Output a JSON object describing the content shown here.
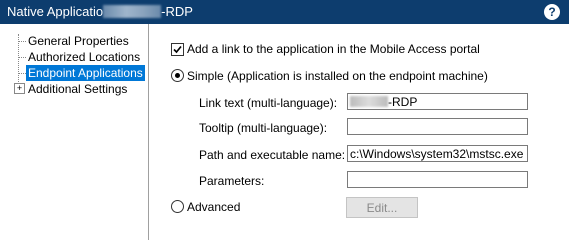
{
  "window": {
    "title_prefix": "Native Applicatio",
    "title_suffix": "-RDP",
    "help_label": "?"
  },
  "sidebar": {
    "items": [
      {
        "label": "General Properties"
      },
      {
        "label": "Authorized Locations"
      },
      {
        "label": "Endpoint Applications",
        "selected": true
      },
      {
        "label": "Additional Settings",
        "expander": "+"
      }
    ]
  },
  "form": {
    "portal_link": {
      "label": "Add a link to the application in the Mobile Access portal",
      "checked": true
    },
    "simple": {
      "label": "Simple (Application is installed on the endpoint machine)",
      "selected": true
    },
    "link_text": {
      "label": "Link text (multi-language):",
      "value": "-RDP"
    },
    "tooltip": {
      "label": "Tooltip (multi-language):",
      "value": ""
    },
    "path": {
      "label": "Path and executable name:",
      "value": "c:\\Windows\\system32\\mstsc.exe"
    },
    "parameters": {
      "label": "Parameters:",
      "value": ""
    },
    "advanced": {
      "label": "Advanced",
      "selected": false
    },
    "edit_button": "Edit..."
  },
  "colors": {
    "titlebar": "#0d3d6e",
    "selection": "#0078d7"
  }
}
